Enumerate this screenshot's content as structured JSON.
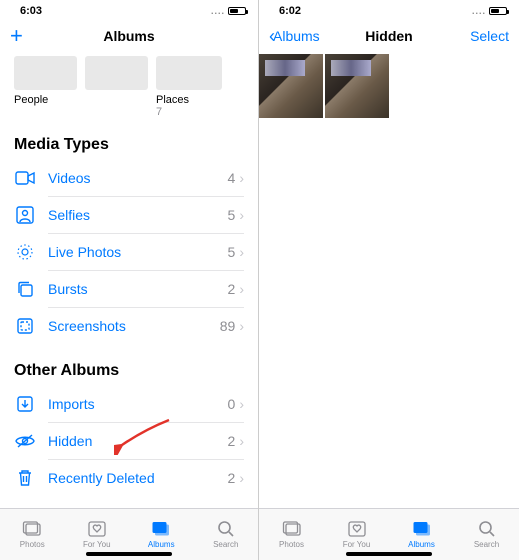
{
  "left": {
    "status": {
      "time": "6:03",
      "signal": "....",
      "battery_pct": 50
    },
    "nav": {
      "title": "Albums"
    },
    "top_albums": [
      {
        "label": "People",
        "count": ""
      },
      {
        "label": "Places",
        "count": "7"
      }
    ],
    "sections": {
      "media_types": {
        "title": "Media Types",
        "rows": [
          {
            "icon": "videos-icon",
            "label": "Videos",
            "count": "4"
          },
          {
            "icon": "selfies-icon",
            "label": "Selfies",
            "count": "5"
          },
          {
            "icon": "livephotos-icon",
            "label": "Live Photos",
            "count": "5"
          },
          {
            "icon": "bursts-icon",
            "label": "Bursts",
            "count": "2"
          },
          {
            "icon": "screenshots-icon",
            "label": "Screenshots",
            "count": "89"
          }
        ]
      },
      "other_albums": {
        "title": "Other Albums",
        "rows": [
          {
            "icon": "imports-icon",
            "label": "Imports",
            "count": "0"
          },
          {
            "icon": "hidden-icon",
            "label": "Hidden",
            "count": "2"
          },
          {
            "icon": "trash-icon",
            "label": "Recently Deleted",
            "count": "2"
          }
        ]
      }
    },
    "tabs": [
      {
        "label": "Photos"
      },
      {
        "label": "For You"
      },
      {
        "label": "Albums"
      },
      {
        "label": "Search"
      }
    ],
    "active_tab": 2
  },
  "right": {
    "status": {
      "time": "6:02",
      "signal": "....",
      "battery_pct": 50
    },
    "nav": {
      "back": "Albums",
      "title": "Hidden",
      "action": "Select"
    },
    "tabs": [
      {
        "label": "Photos"
      },
      {
        "label": "For You"
      },
      {
        "label": "Albums"
      },
      {
        "label": "Search"
      }
    ],
    "active_tab": 2,
    "photo_count": 2
  },
  "colors": {
    "tint": "#007aff",
    "gray": "#8e8e93",
    "arrow": "#e2332a"
  }
}
